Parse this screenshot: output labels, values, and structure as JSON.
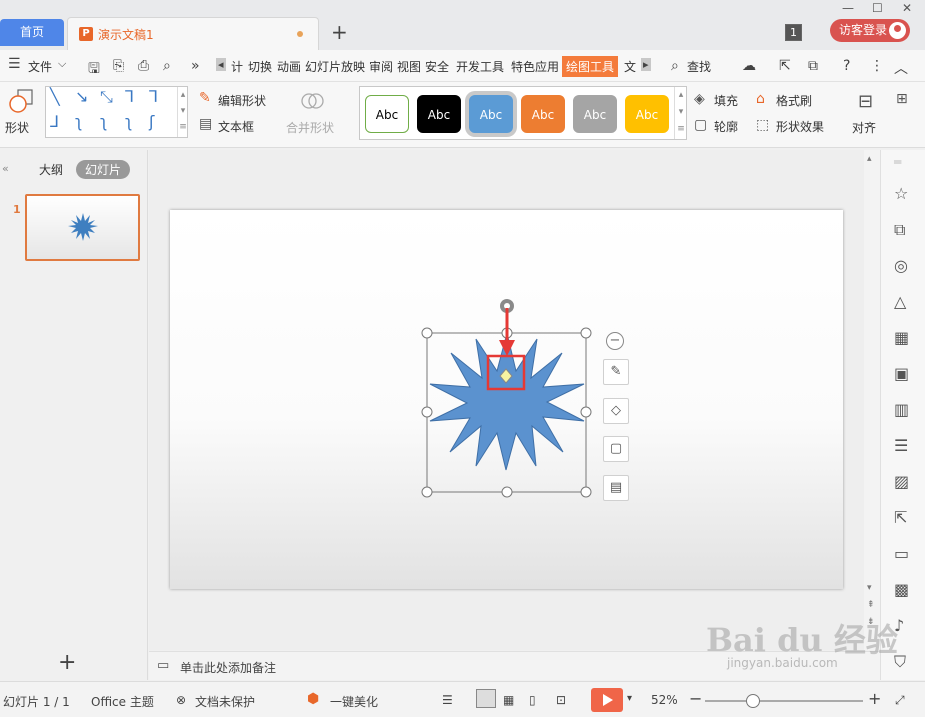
{
  "titlebar": {
    "home_tab": "首页",
    "doc_tab": "演示文稿1",
    "new_tab": "+",
    "window_count": "1",
    "login": "访客登录"
  },
  "menu": {
    "file": "文件",
    "tabs": [
      "计",
      "切换",
      "动画",
      "幻灯片放映",
      "审阅",
      "视图",
      "安全",
      "开发工具",
      "特色应用",
      "绘图工具",
      "文"
    ],
    "active_tab": "绘图工具",
    "search": "查找"
  },
  "ribbon": {
    "shape_label": "形状",
    "edit_shape": "编辑形状",
    "text_box": "文本框",
    "merge_shape": "合并形状",
    "styles": [
      {
        "label": "Abc",
        "bg": "#ffffff",
        "fg": "#000000",
        "border": "#70ad47"
      },
      {
        "label": "Abc",
        "bg": "#000000",
        "fg": "#ffffff",
        "border": "#000000"
      },
      {
        "label": "Abc",
        "bg": "#5b9bd5",
        "fg": "#ffffff",
        "border": "#5b9bd5"
      },
      {
        "label": "Abc",
        "bg": "#ed7d31",
        "fg": "#ffffff",
        "border": "#ed7d31"
      },
      {
        "label": "Abc",
        "bg": "#a5a5a5",
        "fg": "#ffffff",
        "border": "#a5a5a5"
      },
      {
        "label": "Abc",
        "bg": "#ffc000",
        "fg": "#ffffff",
        "border": "#ffc000"
      }
    ],
    "fill": "填充",
    "format_painter": "格式刷",
    "outline": "轮廓",
    "shape_effect": "形状效果",
    "align": "对齐"
  },
  "left_panel": {
    "outline_tab": "大纲",
    "slides_tab": "幻灯片",
    "slide_number": "1",
    "add_slide": "+"
  },
  "notes": {
    "placeholder": "单击此处添加备注"
  },
  "status": {
    "slide_count": "幻灯片 1 / 1",
    "theme": "Office 主题",
    "protection": "文档未保护",
    "beautify": "一键美化",
    "zoom": "52%"
  },
  "watermark": {
    "main": "Bai du 经验",
    "sub": "jingyan.baidu.com"
  },
  "colors": {
    "accent": "#f47b3b",
    "shape_fill": "#5b92cf",
    "highlight": "#e53935"
  }
}
